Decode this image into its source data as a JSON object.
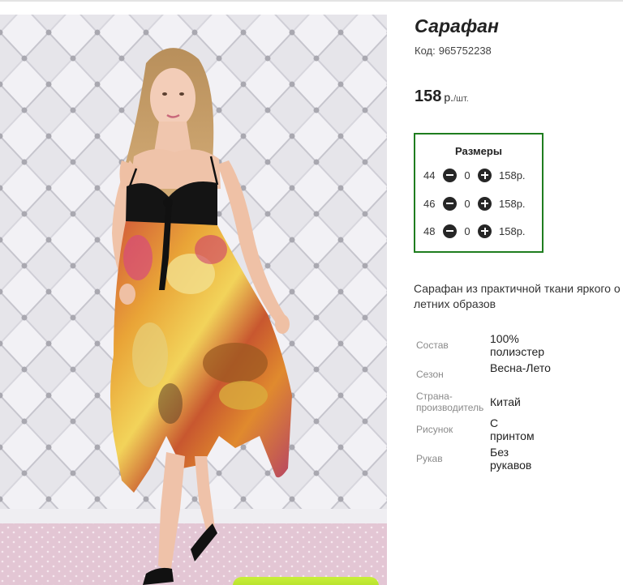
{
  "product": {
    "title": "Сарафан",
    "sku_label": "Код:",
    "sku": "965752238",
    "price": "158",
    "currency": "р.",
    "unit": "/шт."
  },
  "sizes": {
    "title": "Размеры",
    "rows": [
      {
        "size": "44",
        "qty": "0",
        "price": "158р."
      },
      {
        "size": "46",
        "qty": "0",
        "price": "158р."
      },
      {
        "size": "48",
        "qty": "0",
        "price": "158р."
      }
    ]
  },
  "description": {
    "line1": "Сарафан из практичной ткани яркого о",
    "line2": "летних образов"
  },
  "properties": [
    {
      "key": "Состав",
      "value": "100% полиэстер"
    },
    {
      "key": "Сезон",
      "value": "Весна-Лето"
    },
    {
      "key": "Страна-производитель",
      "value": "Китай"
    },
    {
      "key": "Рисунок",
      "value": "С принтом"
    },
    {
      "key": "Рукав",
      "value": "Без рукавов"
    }
  ],
  "colors": {
    "accent_green": "#1f7d1f",
    "cart_button": "#b5e02a"
  },
  "icons": {
    "minus": "minus-circle-icon",
    "plus": "plus-circle-icon"
  }
}
